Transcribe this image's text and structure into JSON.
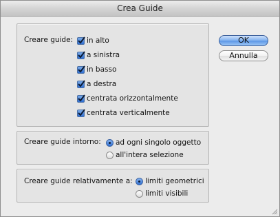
{
  "window": {
    "title": "Crea Guide"
  },
  "buttons": {
    "ok": "OK",
    "cancel": "Annulla"
  },
  "guides_group": {
    "label": "Creare guide:",
    "options": [
      {
        "label": "in alto",
        "checked": true
      },
      {
        "label": "a sinistra",
        "checked": true
      },
      {
        "label": "in basso",
        "checked": true
      },
      {
        "label": "a destra",
        "checked": true
      },
      {
        "label": "centrata orizzontalmente",
        "checked": true
      },
      {
        "label": "centrata verticalmente",
        "checked": true
      }
    ]
  },
  "around_group": {
    "label": "Creare guide intorno:",
    "options": [
      {
        "label": "ad ogni singolo oggetto",
        "selected": true
      },
      {
        "label": "all'intera selezione",
        "selected": false
      }
    ]
  },
  "relative_group": {
    "label": "Creare guide relativamente a:",
    "options": [
      {
        "label": "limiti geometrici",
        "selected": true
      },
      {
        "label": "limiti visibili",
        "selected": false
      }
    ]
  }
}
